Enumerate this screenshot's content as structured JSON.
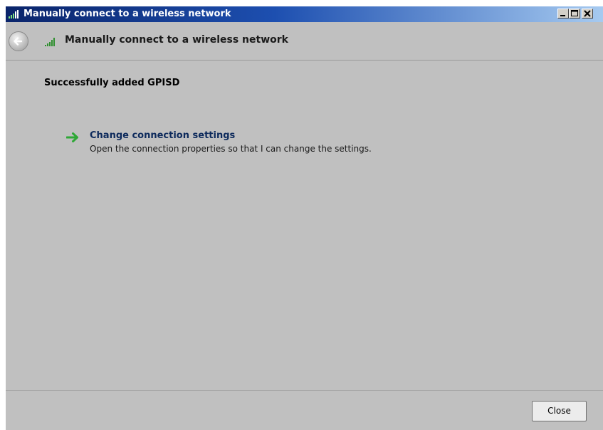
{
  "window": {
    "title": "Manually connect to a wireless network",
    "controls": {
      "minimize_icon": "minimize-icon",
      "maximize_icon": "maximize-icon",
      "close_icon": "close-icon"
    }
  },
  "nav": {
    "back_icon": "back-arrow-icon",
    "network_icon": "wireless-signal-icon",
    "title": "Manually connect to a wireless network"
  },
  "content": {
    "status": "Successfully added GPISD",
    "option": {
      "icon": "green-arrow-icon",
      "title": "Change connection settings",
      "description": "Open the connection properties so that I can change the settings."
    }
  },
  "footer": {
    "close_label": "Close"
  },
  "colors": {
    "titlebar_start": "#0a246a",
    "titlebar_end": "#a6caf0",
    "background": "#c0c0c0",
    "link_title": "#0d2a5c",
    "arrow_green": "#2ea836"
  }
}
